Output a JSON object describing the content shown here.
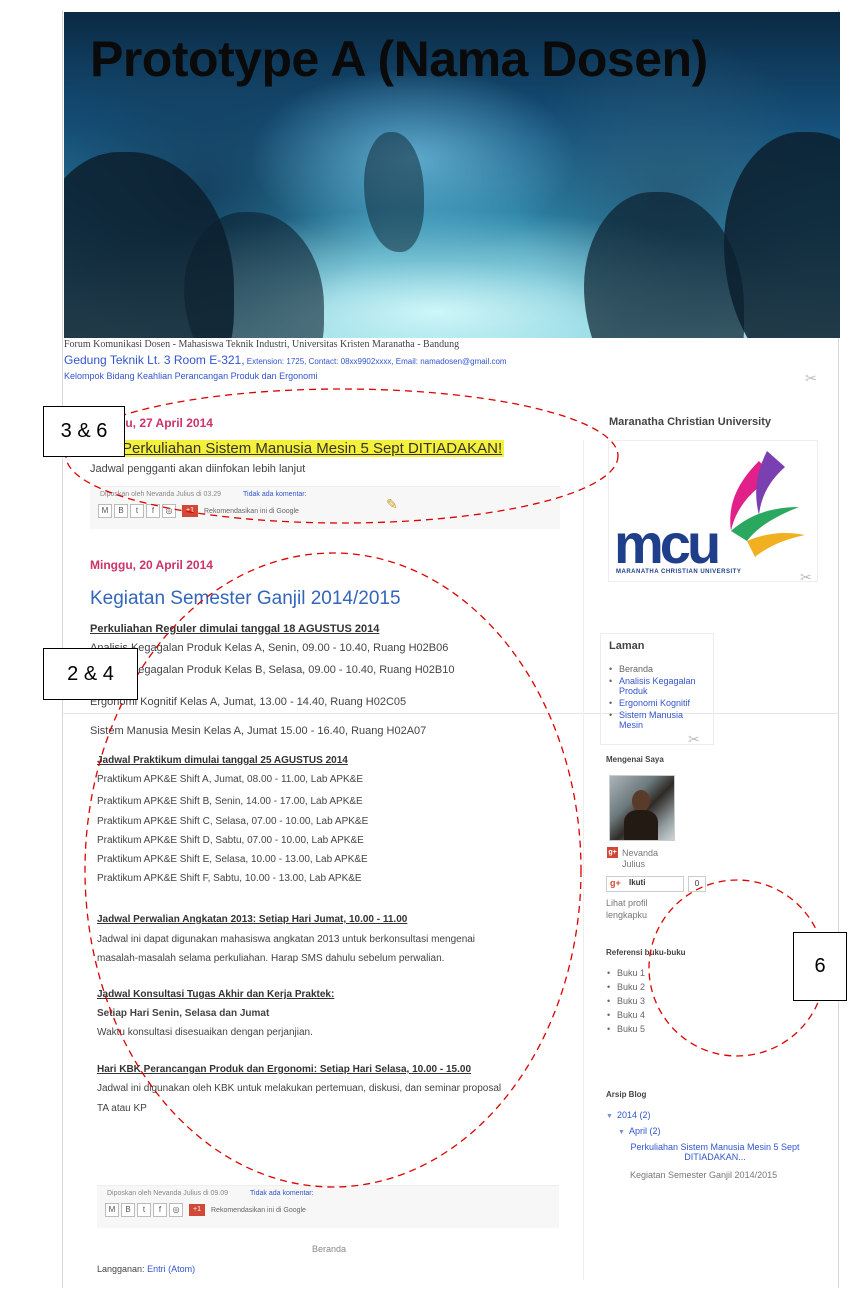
{
  "header": {
    "title": "Prototype A (Nama Dosen)",
    "description_line1": "Forum Komunikasi Dosen - Mahasiswa Teknik Industri, Universitas Kristen Maranatha - Bandung",
    "description_line2_main": "Gedung Teknik Lt. 3 Room E-321,",
    "description_line2_small": " Extension: 1725, Contact: 08xx9902xxxx, Email: namadosen@gmail.com",
    "description_line3": "Kelompok Bidang Keahlian Perancangan Produk dan Ergonomi"
  },
  "post1": {
    "date": "Minggu, 27 April 2014",
    "title": "Perkuliahan Sistem Manusia Mesin 5 Sept DITIADAKAN!",
    "body": "Jadwal pengganti akan diinfokan lebih lanjut",
    "footer_posted": "Diposkan oleh Nevanda Julius di 03.29",
    "footer_comments": "Tidak ada komentar:",
    "share_recommend": "Rekomendasikan ini di Google",
    "gplus_label": "+1"
  },
  "post2": {
    "date": "Minggu, 20 April 2014",
    "title": "Kegiatan Semester Ganjil 2014/2015",
    "section1_head": "Perkuliahan Reguler dimulai tanggal 18 AGUSTUS 2014",
    "section1_lines": [
      "Analisis Kegagalan Produk Kelas A, Senin, 09.00 - 10.40, Ruang H02B06",
      "Analisis Kegagalan Produk Kelas B, Selasa, 09.00 - 10.40, Ruang H02B10",
      "Ergonomi Kognitif Kelas A, Jumat, 13.00 - 14.40, Ruang H02C05",
      "Sistem Manusia Mesin Kelas A, Jumat 15.00 - 16.40, Ruang H02A07"
    ],
    "section2_head": "Jadwal Praktikum dimulai tanggal 25 AGUSTUS 2014",
    "section2_lines": [
      "Praktikum APK&E Shift A, Jumat, 08.00 - 11.00, Lab APK&E",
      "Praktikum APK&E Shift B, Senin, 14.00 - 17.00, Lab APK&E",
      "Praktikum APK&E Shift C, Selasa, 07.00 - 10.00, Lab APK&E",
      "Praktikum APK&E Shift D, Sabtu, 07.00 - 10.00, Lab APK&E",
      "Praktikum APK&E Shift E, Selasa, 10.00 - 13.00, Lab APK&E",
      "Praktikum APK&E Shift F, Sabtu, 10.00 - 13.00, Lab APK&E"
    ],
    "section3_head": "Jadwal Perwalian Angkatan 2013: Setiap Hari Jumat, 10.00 - 11.00",
    "section3_lines": [
      "Jadwal ini dapat digunakan mahasiswa angkatan 2013 untuk berkonsultasi mengenai",
      "masalah-masalah selama perkuliahan. Harap SMS dahulu sebelum perwalian."
    ],
    "section4_head": "Jadwal Konsultasi Tugas Akhir dan Kerja Praktek:",
    "section4_sub": "Setiap Hari Senin, Selasa dan Jumat",
    "section4_line": "Waktu konsultasi disesuaikan dengan perjanjian.",
    "section5_head": "Hari KBK Perancangan Produk dan Ergonomi: Setiap Hari Selasa, 10.00 - 15.00",
    "section5_lines": [
      "Jadwal ini digunakan oleh KBK untuk melakukan pertemuan, diskusi, dan seminar proposal",
      "TA atau KP"
    ],
    "footer_posted": "Diposkan oleh Nevanda Julius di 09.09",
    "footer_comments": "Tidak ada komentar:",
    "share_recommend": "Rekomendasikan ini di Google",
    "gplus_label": "+1"
  },
  "nav": {
    "home": "Beranda",
    "subscribe_label": "Langganan:",
    "subscribe_link": "Entri (Atom)"
  },
  "sidebar": {
    "university_title": "Maranatha Christian University",
    "logo_text": "mcu",
    "logo_subtext": "MARANATHA CHRISTIAN UNIVERSITY",
    "pages_title": "Laman",
    "pages": [
      "Beranda",
      "Analisis Kegagalan Produk",
      "Ergonomi Kognitif",
      "Sistem Manusia Mesin"
    ],
    "about_title": "Mengenai Saya",
    "profile_name": "Nevanda Julius",
    "follow_label": "Ikuti",
    "follow_count": "0",
    "profile_link": "Lihat profil lengkapku",
    "books_title": "Referensi buku-buku",
    "books": [
      "Buku 1",
      "Buku 2",
      "Buku 3",
      "Buku 4",
      "Buku 5"
    ],
    "archive_title": "Arsip Blog",
    "archive_year": "2014 (2)",
    "archive_month": "April (2)",
    "archive_post1": "Perkuliahan Sistem Manusia Mesin 5 Sept DITIADAKAN...",
    "archive_post2": "Kegiatan Semester Ganjil 2014/2015"
  },
  "annotations": {
    "label_a": "3 & 6",
    "label_b": "2 & 4",
    "label_c": "6",
    "stroke_color": "#dd0000"
  },
  "colors": {
    "date": "#cc3366",
    "link": "#3355cc",
    "highlight": "#f5f03a"
  }
}
